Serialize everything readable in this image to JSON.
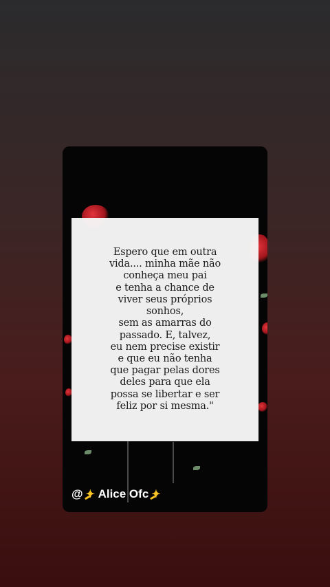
{
  "story": {
    "quote": "Espero que em outra\nvida....  minha mãe não\nconheça meu pai\ne tenha a chance de\nviver seus próprios\nsonhos,\nsem as amarras do\npassado. E, talvez,\neu nem precise existir\ne que eu não tenha\nque pagar pelas dores\ndeles  para que ela\npossa se libertar e ser\nfeliz por si mesma.\"",
    "handle_prefix": "@",
    "handle_name": "Alice Ofc",
    "icons": [
      "sparkle-icon",
      "sparkle-icon"
    ],
    "colors": {
      "accent_red": "#c91f26",
      "sparkle": "#f7c325"
    }
  }
}
